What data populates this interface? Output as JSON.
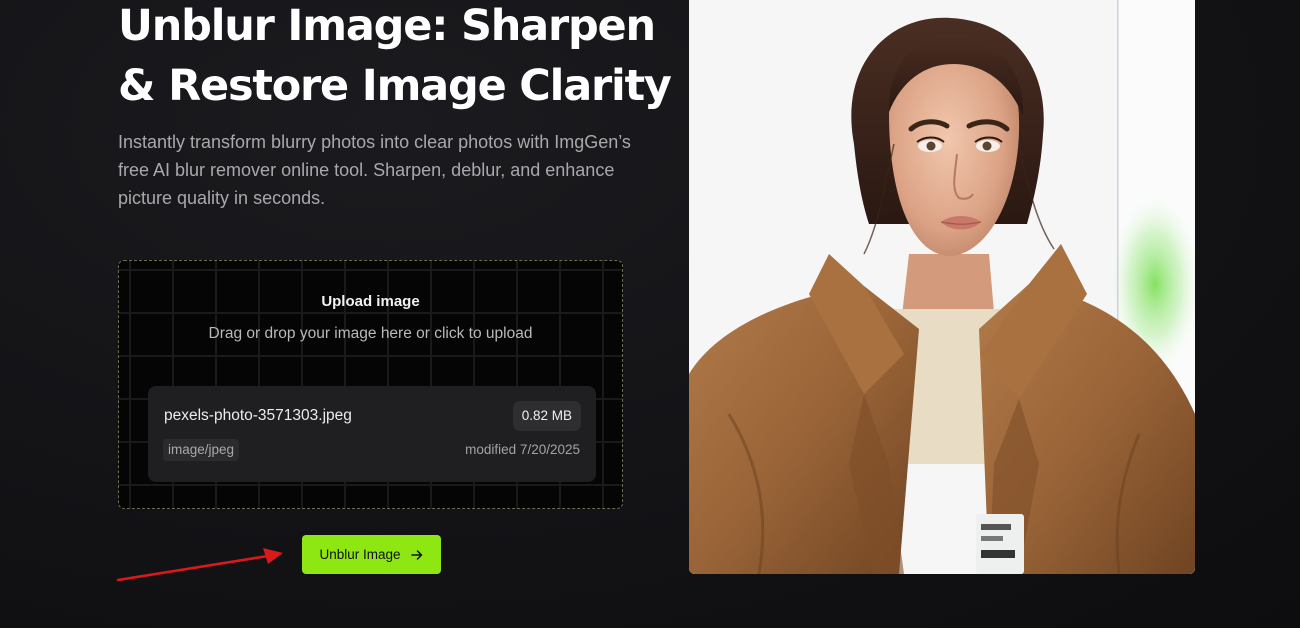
{
  "hero": {
    "title_line1": "Unblur Image: Sharpen",
    "title_line2": "& Restore Image Clarity",
    "subtitle": "Instantly transform blurry photos into clear photos with ImgGen’s free AI blur remover online tool. Sharpen, deblur, and enhance picture quality in seconds."
  },
  "upload": {
    "title": "Upload image",
    "hint": "Drag or drop your image here or click to upload",
    "file": {
      "name": "pexels-photo-3571303.jpeg",
      "size": "0.82 MB",
      "type": "image/jpeg",
      "modified": "modified 7/20/2025"
    }
  },
  "cta": {
    "label": "Unblur Image",
    "icon": "arrow-right-icon"
  },
  "annotation": {
    "icon": "red-arrow-icon"
  },
  "preview": {
    "image": "portrait-photo"
  },
  "colors": {
    "background": "#131316",
    "accent": "#8ee612",
    "annotation": "#d9191c",
    "card": "#1f1f21",
    "muted_text": "#a8a8ad"
  }
}
